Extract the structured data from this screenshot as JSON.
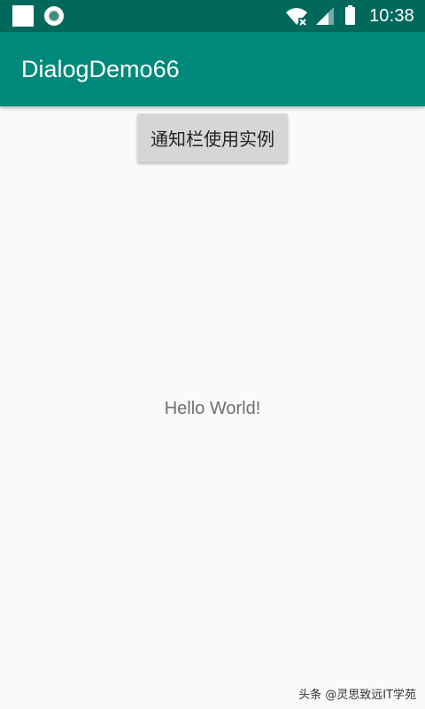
{
  "status_bar": {
    "time": "10:38",
    "icons": [
      "notification-square-icon",
      "notification-ring-icon",
      "wifi-no-internet-icon",
      "cellular-signal-icon",
      "battery-icon"
    ]
  },
  "app_bar": {
    "title": "DialogDemo66"
  },
  "main": {
    "button_label": "通知栏使用实例",
    "hello_text": "Hello World!"
  },
  "watermark": "头条 @灵思致远IT学苑",
  "colors": {
    "status_bar": "#00695c",
    "app_bar": "#00897b",
    "background": "#fafafa",
    "button": "#d6d6d6"
  }
}
